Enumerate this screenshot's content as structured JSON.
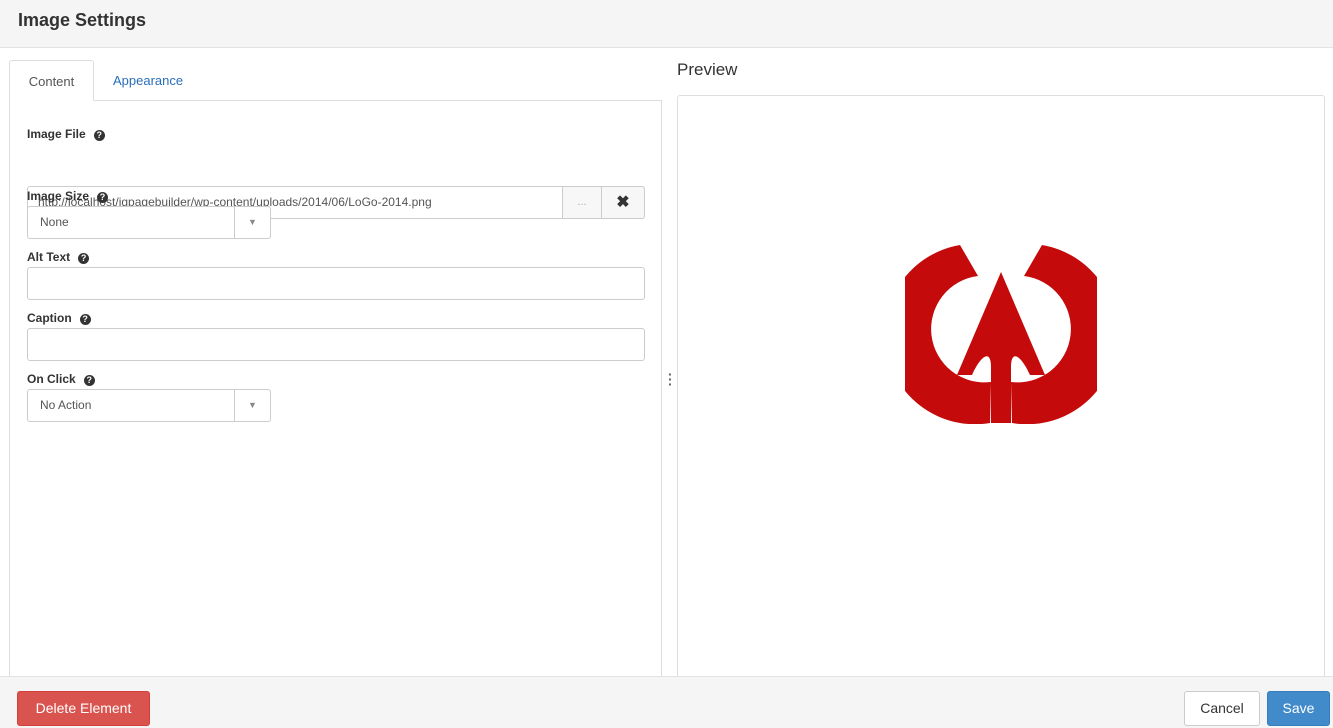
{
  "header": {
    "title": "Image Settings"
  },
  "tabs": [
    {
      "label": "Content",
      "active": true
    },
    {
      "label": "Appearance",
      "active": false
    }
  ],
  "form": {
    "image_file": {
      "label": "Image File",
      "value": "http://localhost/igpagebuilder/wp-content/uploads/2014/06/LoGo-2014.png",
      "browse_label": "...",
      "clear_icon": "close-icon"
    },
    "image_size": {
      "label": "Image Size",
      "value": "None"
    },
    "alt_text": {
      "label": "Alt Text",
      "value": ""
    },
    "caption": {
      "label": "Caption",
      "value": ""
    },
    "on_click": {
      "label": "On Click",
      "value": "No Action"
    },
    "help_icon": "?"
  },
  "preview": {
    "title": "Preview",
    "logo_color": "#c40a0a"
  },
  "footer": {
    "delete_label": "Delete Element",
    "cancel_label": "Cancel",
    "save_label": "Save"
  },
  "colors": {
    "danger": "#d9534f",
    "primary": "#428bca",
    "link": "#2a6ebb"
  }
}
